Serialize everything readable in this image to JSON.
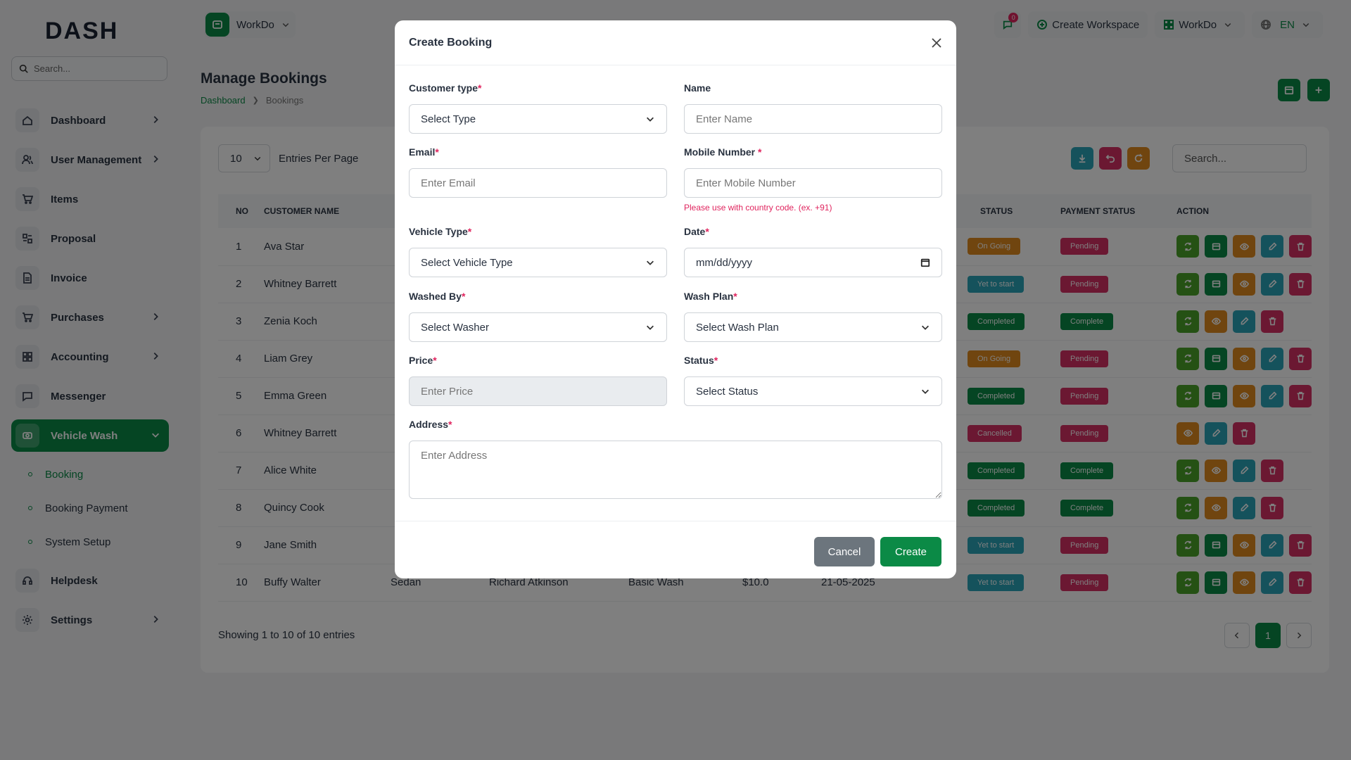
{
  "logo": {
    "text_a": "DASH",
    "text_b": ""
  },
  "sidebar": {
    "search_placeholder": "Search...",
    "items": [
      {
        "label": "Dashboard",
        "icon": "home-icon",
        "chevron": true
      },
      {
        "label": "User Management",
        "icon": "users-icon",
        "chevron": true
      },
      {
        "label": "Items",
        "icon": "cart-icon",
        "chevron": false
      },
      {
        "label": "Proposal",
        "icon": "proposal-icon",
        "chevron": false
      },
      {
        "label": "Invoice",
        "icon": "invoice-icon",
        "chevron": false
      },
      {
        "label": "Purchases",
        "icon": "cart-icon",
        "chevron": true
      },
      {
        "label": "Accounting",
        "icon": "grid-icon",
        "chevron": true
      },
      {
        "label": "Messenger",
        "icon": "chat-icon",
        "chevron": false
      },
      {
        "label": "Vehicle Wash",
        "icon": "car-wash-icon",
        "chevron": true,
        "active": true
      }
    ],
    "sub_items": [
      {
        "label": "Booking",
        "active": true
      },
      {
        "label": "Booking Payment"
      },
      {
        "label": "System Setup"
      }
    ],
    "items_after": [
      {
        "label": "Helpdesk",
        "icon": "headset-icon",
        "chevron": false
      },
      {
        "label": "Settings",
        "icon": "gear-icon",
        "chevron": true
      }
    ]
  },
  "topbar": {
    "workspace": "WorkDo",
    "message_count": "0",
    "create_workspace": "Create Workspace",
    "workspace_switch": "WorkDo",
    "language": "EN"
  },
  "page": {
    "title": "Manage Bookings",
    "breadcrumb": {
      "home": "Dashboard",
      "current": "Bookings"
    }
  },
  "table": {
    "entries_value": "10",
    "entries_label": "Entries Per Page",
    "search_placeholder": "Search...",
    "columns": {
      "no": "NO",
      "customer": "CUSTOMER NAME",
      "status": "STATUS",
      "payment": "PAYMENT STATUS",
      "action": "ACTION"
    },
    "rows": [
      {
        "no": "1",
        "name": "Ava Star",
        "status": "On Going",
        "status_color": "#e08a1e",
        "payment": "Pending",
        "payment_color": "#d63064",
        "actions": [
          "sync",
          "card",
          "eye",
          "edit",
          "delete"
        ]
      },
      {
        "no": "2",
        "name": "Whitney Barrett",
        "status": "Yet to start",
        "status_color": "#2aa4b8",
        "payment": "Pending",
        "payment_color": "#d63064",
        "actions": [
          "sync",
          "card",
          "eye",
          "edit",
          "delete"
        ]
      },
      {
        "no": "3",
        "name": "Zenia Koch",
        "status": "Completed",
        "status_color": "#0b8a46",
        "payment": "Complete",
        "payment_color": "#0b8a46",
        "actions": [
          "sync",
          "eye",
          "edit",
          "delete"
        ]
      },
      {
        "no": "4",
        "name": "Liam Grey",
        "status": "On Going",
        "status_color": "#e08a1e",
        "payment": "Pending",
        "payment_color": "#d63064",
        "actions": [
          "sync",
          "card",
          "eye",
          "edit",
          "delete"
        ]
      },
      {
        "no": "5",
        "name": "Emma Green",
        "status": "Completed",
        "status_color": "#0b8a46",
        "payment": "Pending",
        "payment_color": "#d63064",
        "actions": [
          "sync",
          "card",
          "eye",
          "edit",
          "delete"
        ]
      },
      {
        "no": "6",
        "name": "Whitney Barrett",
        "status": "Cancelled",
        "status_color": "#d63064",
        "payment": "Pending",
        "payment_color": "#d63064",
        "actions": [
          "eye",
          "edit",
          "delete"
        ]
      },
      {
        "no": "7",
        "name": "Alice White",
        "status": "Completed",
        "status_color": "#0b8a46",
        "payment": "Complete",
        "payment_color": "#0b8a46",
        "actions": [
          "sync",
          "eye",
          "edit",
          "delete"
        ]
      },
      {
        "no": "8",
        "name": "Quincy Cook",
        "status": "Completed",
        "status_color": "#0b8a46",
        "payment": "Complete",
        "payment_color": "#0b8a46",
        "actions": [
          "sync",
          "eye",
          "edit",
          "delete"
        ]
      },
      {
        "no": "9",
        "name": "Jane Smith",
        "status": "Yet to start",
        "status_color": "#2aa4b8",
        "payment": "Pending",
        "payment_color": "#d63064",
        "actions": [
          "sync",
          "card",
          "eye",
          "edit",
          "delete"
        ]
      },
      {
        "no": "10",
        "name": "Buffy Walter",
        "vehicle": "Sedan",
        "washer": "Richard Atkinson",
        "plan": "Basic Wash",
        "price": "$10.0",
        "date": "21-05-2025",
        "status": "Yet to start",
        "status_color": "#2aa4b8",
        "payment": "Pending",
        "payment_color": "#d63064",
        "actions": [
          "sync",
          "card",
          "eye",
          "edit",
          "delete"
        ]
      }
    ],
    "showing": "Showing 1 to 10 of 10 entries",
    "current_page": "1"
  },
  "modal": {
    "title": "Create Booking",
    "customer_type": {
      "label": "Customer type",
      "value": "Select Type"
    },
    "name": {
      "label": "Name",
      "placeholder": "Enter Name"
    },
    "email": {
      "label": "Email",
      "placeholder": "Enter Email"
    },
    "mobile": {
      "label": "Mobile Number",
      "placeholder": "Enter Mobile Number",
      "hint": "Please use with country code. (ex. +91)"
    },
    "vehicle_type": {
      "label": "Vehicle Type",
      "value": "Select Vehicle Type"
    },
    "date": {
      "label": "Date",
      "value": "mm/dd/yyyy"
    },
    "washed_by": {
      "label": "Washed By",
      "value": "Select Washer"
    },
    "wash_plan": {
      "label": "Wash Plan",
      "value": "Select Wash Plan"
    },
    "price": {
      "label": "Price",
      "placeholder": "Enter Price"
    },
    "status": {
      "label": "Status",
      "value": "Select Status"
    },
    "address": {
      "label": "Address",
      "placeholder": "Enter Address"
    },
    "required_mark": "*",
    "cancel": "Cancel",
    "create": "Create"
  },
  "colors": {
    "accent": "#0b8a46",
    "danger": "#e0245e",
    "info": "#2aa4b8",
    "warning": "#e08a1e"
  }
}
